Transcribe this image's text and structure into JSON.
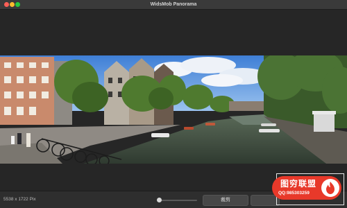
{
  "window": {
    "title": "WidsMob Panorama",
    "controls": [
      "close-icon",
      "minimize-icon",
      "zoom-icon"
    ]
  },
  "image": {
    "subject": "panorama-photo"
  },
  "statusbar": {
    "dimensions": "5538 x 1722 Pix",
    "zoom_level": 0.0,
    "crop_label": "裁剪",
    "save_label": ""
  },
  "watermark": {
    "title": "图穷联盟",
    "subtitle": "QQ:985303259",
    "icon": "flame-icon",
    "color": "#e8392a"
  }
}
